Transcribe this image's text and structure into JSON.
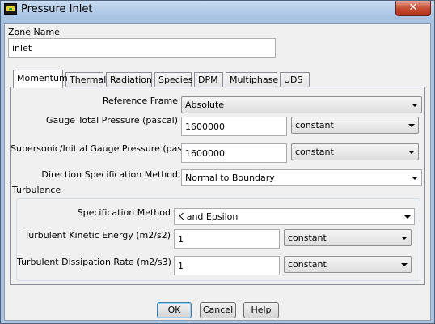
{
  "window": {
    "title": "Pressure Inlet",
    "close_symbol": "✕"
  },
  "zone": {
    "label": "Zone Name",
    "value": "inlet"
  },
  "tabs": [
    "Momentum",
    "Thermal",
    "Radiation",
    "Species",
    "DPM",
    "Multiphase",
    "UDS"
  ],
  "active_tab": "Momentum",
  "momentum": {
    "reference_frame": {
      "label": "Reference Frame",
      "value": "Absolute"
    },
    "gauge_total_pressure": {
      "label": "Gauge Total Pressure (pascal)",
      "value": "1600000",
      "profile": "constant"
    },
    "supersonic_pressure": {
      "label": "Supersonic/Initial Gauge Pressure (pascal)",
      "value": "1600000",
      "profile": "constant"
    },
    "direction_method": {
      "label": "Direction Specification Method",
      "value": "Normal to Boundary"
    }
  },
  "turbulence": {
    "title": "Turbulence",
    "spec_method": {
      "label": "Specification Method",
      "value": "K and Epsilon"
    },
    "kinetic_energy": {
      "label": "Turbulent Kinetic Energy (m2/s2)",
      "value": "1",
      "profile": "constant"
    },
    "dissipation_rate": {
      "label": "Turbulent Dissipation Rate (m2/s3)",
      "value": "1",
      "profile": "constant"
    }
  },
  "buttons": {
    "ok": "OK",
    "cancel": "Cancel",
    "help": "Help"
  },
  "icons": {
    "app": "fluent-app-icon",
    "close": "close-icon",
    "dropdown": "chevron-down-icon"
  },
  "colors": {
    "window_frame": "#a9c4e2",
    "dialog_bg": "#f0f0f0",
    "close_button": "#c5492f"
  }
}
